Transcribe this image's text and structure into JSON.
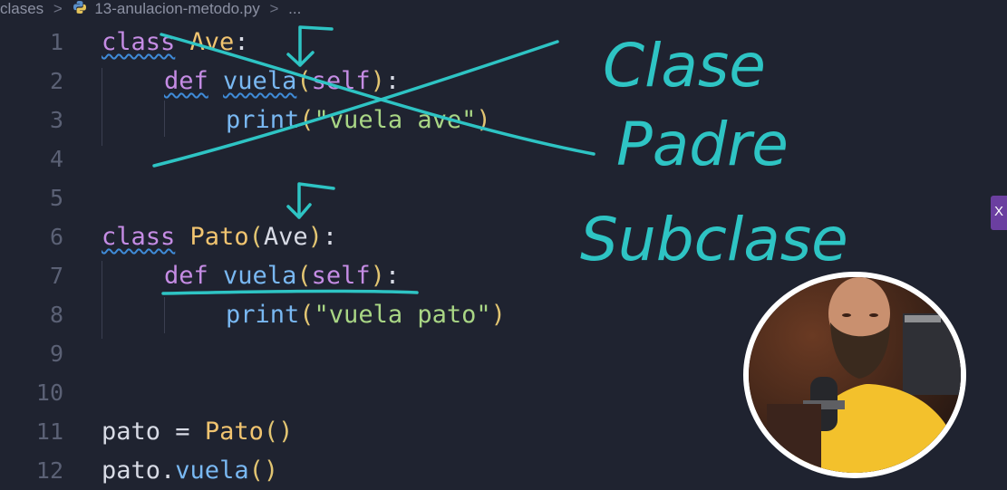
{
  "breadcrumb": {
    "folder": "clases",
    "separator": ">",
    "file": "13-anulacion-metodo.py",
    "ellipsis": "..."
  },
  "code_lines": [
    {
      "number": "1"
    },
    {
      "number": "2"
    },
    {
      "number": "3"
    },
    {
      "number": "4"
    },
    {
      "number": "5"
    },
    {
      "number": "6"
    },
    {
      "number": "7"
    },
    {
      "number": "8"
    },
    {
      "number": "9"
    },
    {
      "number": "10"
    },
    {
      "number": "11"
    },
    {
      "number": "12"
    }
  ],
  "code": {
    "l1_kw": "class",
    "l1_name": "Ave",
    "l1_end": ":",
    "l2_kw": "def",
    "l2_fn": "vuela",
    "l2_open": "(",
    "l2_self": "self",
    "l2_close": ")",
    "l2_end": ":",
    "l3_fn": "print",
    "l3_open": "(",
    "l3_str": "\"vuela ave\"",
    "l3_close": ")",
    "l6_kw": "class",
    "l6_name": "Pato",
    "l6_open": "(",
    "l6_base": "Ave",
    "l6_close": ")",
    "l6_end": ":",
    "l7_kw": "def",
    "l7_fn": "vuela",
    "l7_open": "(",
    "l7_self": "self",
    "l7_close": ")",
    "l7_end": ":",
    "l8_fn": "print",
    "l8_open": "(",
    "l8_str": "\"vuela pato\"",
    "l8_close": ")",
    "l11_var": "pato",
    "l11_eq": " = ",
    "l11_cls": "Pato",
    "l11_call": "()",
    "l12_var": "pato",
    "l12_dot": ".",
    "l12_fn": "vuela",
    "l12_call": "()"
  },
  "annotations": {
    "word1": "Clase",
    "word2": "Padre",
    "word3": "Subclase",
    "color": "#2ec4c4"
  },
  "sidebar_tab": {
    "label": "X",
    "color": "#6b3fa0"
  },
  "theme": {
    "background": "#1f2330",
    "keyword": "#c58ce4",
    "class": "#f1c470",
    "function": "#79b8f2",
    "string": "#a9d685"
  }
}
